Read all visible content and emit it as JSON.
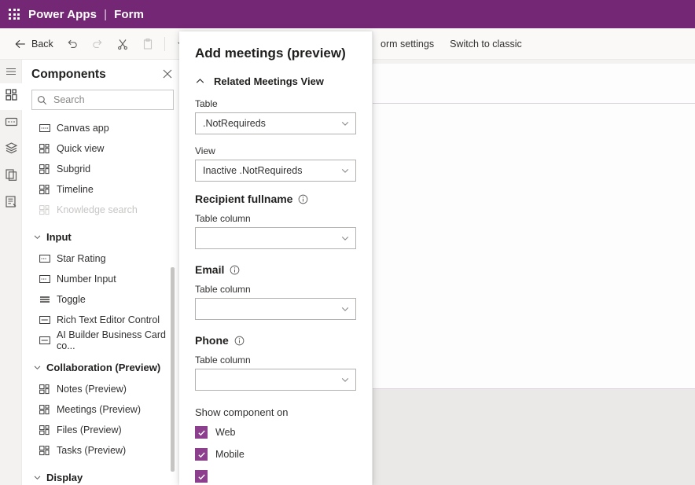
{
  "appbar": {
    "waffle_icon": "waffle-menu-icon",
    "product": "Power Apps",
    "separator": "|",
    "context": "Form"
  },
  "command_bar": {
    "back_label": "Back",
    "buttons": [
      {
        "name": "undo",
        "icon": "undo-icon"
      },
      {
        "name": "redo",
        "icon": "redo-icon"
      },
      {
        "name": "cut",
        "icon": "cut-icon"
      },
      {
        "name": "paste",
        "icon": "paste-icon"
      },
      {
        "name": "overflow",
        "icon": "chevron-down-icon"
      }
    ],
    "form_settings_label": "orm settings",
    "switch_to_classic_label": "Switch to classic"
  },
  "rail": {
    "items": [
      {
        "name": "hamburger-menu",
        "icon": "hamburger-icon"
      },
      {
        "name": "components",
        "icon": "components-icon"
      },
      {
        "name": "fields",
        "icon": "field-icon"
      },
      {
        "name": "tables",
        "icon": "data-layers-icon"
      },
      {
        "name": "pages",
        "icon": "copy-pages-icon"
      },
      {
        "name": "form-properties",
        "icon": "form-properties-icon"
      }
    ]
  },
  "components_panel": {
    "title": "Components",
    "close_icon": "close-icon",
    "search": {
      "placeholder": "Search",
      "value": "",
      "icon": "search-icon"
    },
    "items": [
      {
        "label": "Canvas app",
        "icon": "canvas-app-icon",
        "disabled": false
      },
      {
        "label": "Quick view",
        "icon": "grid-icon",
        "disabled": false
      },
      {
        "label": "Subgrid",
        "icon": "grid-icon",
        "disabled": false
      },
      {
        "label": "Timeline",
        "icon": "grid-icon",
        "disabled": false
      },
      {
        "label": "Knowledge search",
        "icon": "grid-icon",
        "disabled": true
      }
    ],
    "groups": [
      {
        "label": "Input",
        "expanded": true,
        "items": [
          {
            "label": "Star Rating",
            "icon": "input-box-icon",
            "disabled": false
          },
          {
            "label": "Number Input",
            "icon": "input-box-icon",
            "disabled": false
          },
          {
            "label": "Toggle",
            "icon": "toggle-lines-icon",
            "disabled": false
          },
          {
            "label": "Rich Text Editor Control",
            "icon": "text-box-icon",
            "disabled": false
          },
          {
            "label": "AI Builder Business Card co...",
            "icon": "text-box-icon",
            "disabled": false
          }
        ]
      },
      {
        "label": "Collaboration (Preview)",
        "expanded": true,
        "items": [
          {
            "label": "Notes (Preview)",
            "icon": "grid-icon",
            "disabled": false
          },
          {
            "label": "Meetings (Preview)",
            "icon": "grid-icon",
            "disabled": false
          },
          {
            "label": "Files (Preview)",
            "icon": "grid-icon",
            "disabled": false
          },
          {
            "label": "Tasks (Preview)",
            "icon": "grid-icon",
            "disabled": false
          }
        ]
      },
      {
        "label": "Display",
        "expanded": false,
        "items": []
      }
    ]
  },
  "properties_panel": {
    "title": "Add meetings (preview)",
    "section": {
      "label": "Related Meetings View",
      "chevron_icon": "chevron-up-icon"
    },
    "table_field": {
      "label": "Table",
      "value": ".NotRequireds",
      "chevron_icon": "chevron-down-icon"
    },
    "view_field": {
      "label": "View",
      "value": "Inactive .NotRequireds",
      "chevron_icon": "chevron-down-icon"
    },
    "recipient_fullname": {
      "heading": "Recipient fullname",
      "info_icon": "info-icon",
      "field_label": "Table column",
      "value": "",
      "chevron_icon": "chevron-down-icon"
    },
    "email": {
      "heading": "Email",
      "info_icon": "info-icon",
      "field_label": "Table column",
      "value": "",
      "chevron_icon": "chevron-down-icon"
    },
    "phone": {
      "heading": "Phone",
      "info_icon": "info-icon",
      "field_label": "Table column",
      "value": "",
      "chevron_icon": "chevron-down-icon"
    },
    "show_component_on": {
      "title": "Show component on",
      "options": [
        {
          "label": "Web",
          "checked": true
        },
        {
          "label": "Mobile",
          "checked": true
        },
        {
          "label": "",
          "checked": true
        }
      ]
    }
  },
  "colors": {
    "brand_purple": "#742774",
    "checkbox_purple": "#8c3f8c",
    "canvas_rule": "#ddd3de",
    "panel_border": "#e6e6e6"
  }
}
